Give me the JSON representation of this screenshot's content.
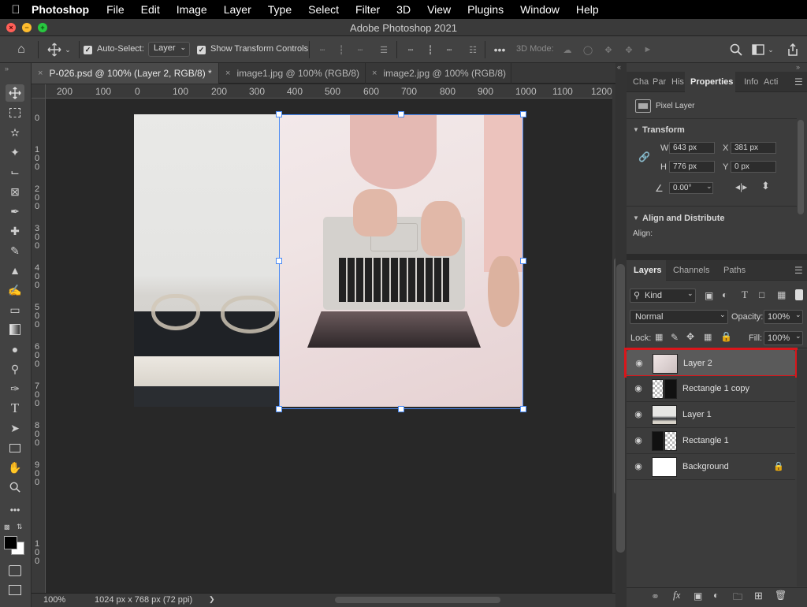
{
  "menubar": {
    "apple": "",
    "app": "Photoshop",
    "items": [
      "File",
      "Edit",
      "Image",
      "Layer",
      "Type",
      "Select",
      "Filter",
      "3D",
      "View",
      "Plugins",
      "Window",
      "Help"
    ]
  },
  "window": {
    "title": "Adobe Photoshop 2021"
  },
  "options": {
    "auto_select_label": "Auto-Select:",
    "auto_select_value": "Layer",
    "show_transform_label": "Show Transform Controls",
    "mode_3d_label": "3D Mode:"
  },
  "tabs": [
    {
      "label": "P-026.psd @ 100% (Layer 2, RGB/8) *",
      "active": true
    },
    {
      "label": "image1.jpg @ 100% (RGB/8)",
      "active": false
    },
    {
      "label": "image2.jpg @ 100% (RGB/8)",
      "active": false
    }
  ],
  "ruler": {
    "top": [
      "200",
      "100",
      "0",
      "100",
      "200",
      "300",
      "400",
      "500",
      "600",
      "700",
      "800",
      "900",
      "1000",
      "1100",
      "1200"
    ],
    "left": [
      "0",
      "1\n0\n0",
      "2\n0\n0",
      "3\n0\n0",
      "4\n0\n0",
      "5\n0\n0",
      "6\n0\n0",
      "7\n0\n0",
      "8\n0\n0",
      "9\n0\n0",
      "1\n0\n0"
    ]
  },
  "status": {
    "zoom": "100%",
    "doc_info": "1024 px x 768 px (72 ppi)",
    "arrow": "❯"
  },
  "panel_tabs": [
    "Cha",
    "Par",
    "His",
    "Properties",
    "Info",
    "Acti"
  ],
  "properties": {
    "layer_type": "Pixel Layer",
    "transform_header": "Transform",
    "w_label": "W",
    "w_value": "643 px",
    "x_label": "X",
    "x_value": "381 px",
    "h_label": "H",
    "h_value": "776 px",
    "y_label": "Y",
    "y_value": "0 px",
    "angle_value": "0.00°",
    "align_header": "Align and Distribute",
    "align_label": "Align:"
  },
  "layers_panel": {
    "tabs": [
      "Layers",
      "Channels",
      "Paths"
    ],
    "kind_label": "Kind",
    "blend_mode": "Normal",
    "opacity_label": "Opacity:",
    "opacity_value": "100%",
    "lock_label": "Lock:",
    "fill_label": "Fill:",
    "fill_value": "100%",
    "layers": [
      {
        "name": "Layer 2",
        "selected": true
      },
      {
        "name": "Rectangle 1 copy",
        "selected": false
      },
      {
        "name": "Layer 1",
        "selected": false
      },
      {
        "name": "Rectangle 1",
        "selected": false
      },
      {
        "name": "Background",
        "selected": false
      }
    ],
    "footer_fx": "fx"
  },
  "colors": {
    "selection_highlight": "#d9161b",
    "transform_box": "#4a8af4"
  }
}
